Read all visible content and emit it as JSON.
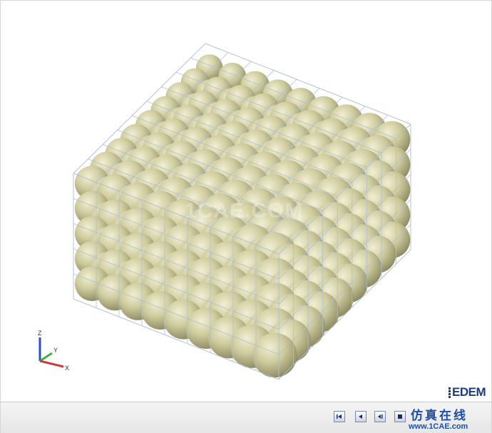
{
  "viewer": {
    "watermark": "1CAE.COM",
    "logo": "EDEM",
    "particle_color": "#cbc898",
    "grid_color": "#aebfd6"
  },
  "axes": {
    "x_label": "X",
    "y_label": "Y",
    "z_label": "Z",
    "x_color": "#c83c3c",
    "y_color": "#3cb43c",
    "z_color": "#2b4fc8"
  },
  "toolbar": {
    "buttons": [
      {
        "name": "first-frame-button",
        "icon": "skip-to-start-icon"
      },
      {
        "name": "previous-frame-button",
        "icon": "step-back-icon"
      },
      {
        "name": "play-reverse-button",
        "icon": "play-reverse-icon"
      },
      {
        "name": "stop-button",
        "icon": "stop-icon"
      }
    ]
  },
  "branding": {
    "chinese": "仿真在线",
    "url": "www.1CAE.com"
  }
}
